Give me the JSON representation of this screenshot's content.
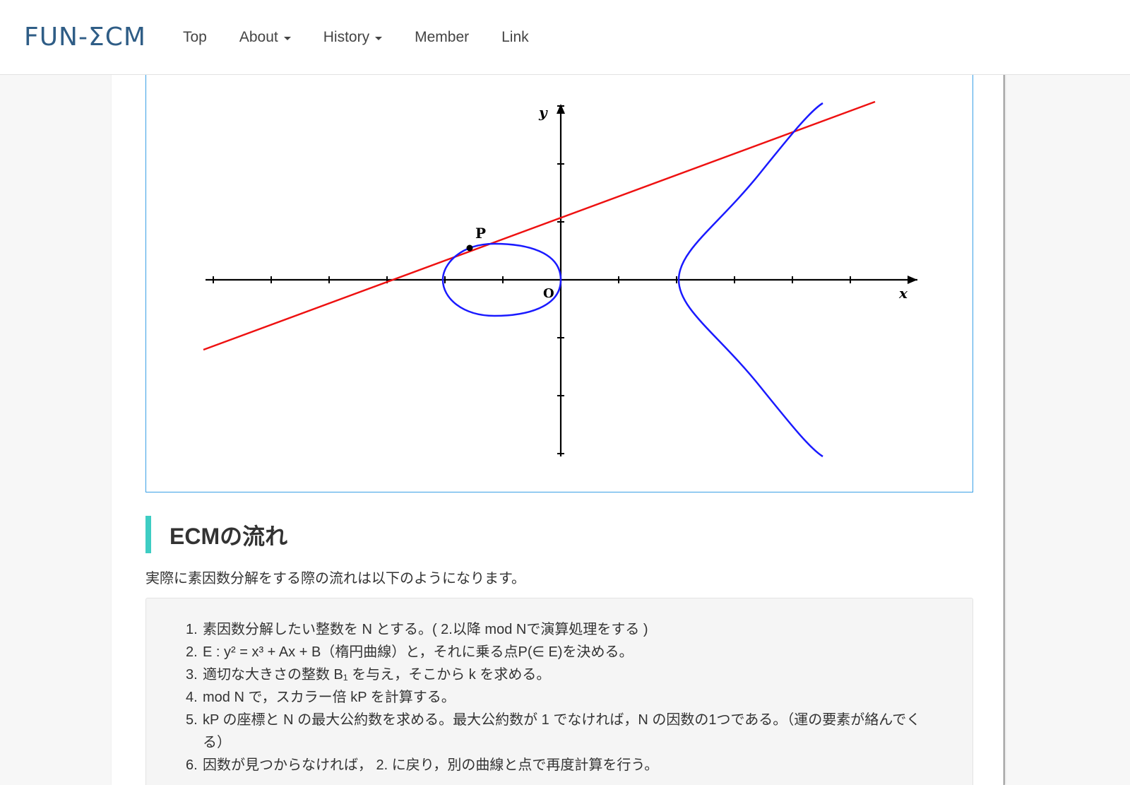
{
  "navbar": {
    "brand": "FUN-ΣCM",
    "items": [
      {
        "label": "Top",
        "dropdown": false
      },
      {
        "label": "About",
        "dropdown": true
      },
      {
        "label": "History",
        "dropdown": true
      },
      {
        "label": "Member",
        "dropdown": false
      },
      {
        "label": "Link",
        "dropdown": false
      }
    ]
  },
  "figure": {
    "y_label": "y",
    "x_label": "x",
    "point_label": "P",
    "origin_label": "O",
    "colors": {
      "curve": "#1a1aff",
      "line": "#ee1111",
      "axes": "#000000"
    }
  },
  "section": {
    "heading": "ECMの流れ",
    "intro": "実際に素因数分解をする際の流れは以下のようになります。"
  },
  "steps": [
    {
      "num": "1.",
      "text": "素因数分解したい整数を N とする。( 2.以降 mod Nで演算処理をする )"
    },
    {
      "num": "2.",
      "text": "E : y² = x³ + Ax + B（楕円曲線）と，それに乗る点P(∈ E)を決める。"
    },
    {
      "num": "3.",
      "text": "適切な大きさの整数 B₁ を与え，そこから k を求める。"
    },
    {
      "num": "4.",
      "text": "mod N で，スカラー倍 kP を計算する。"
    },
    {
      "num": "5.",
      "text": "kP の座標と N の最大公約数を求める。最大公約数が 1 でなければ，N の因数の1つである。（運の要素が絡んでくる）"
    },
    {
      "num": "6.",
      "text": "因数が見つからなければ， 2. に戻り，別の曲線と点で再度計算を行う。"
    }
  ]
}
